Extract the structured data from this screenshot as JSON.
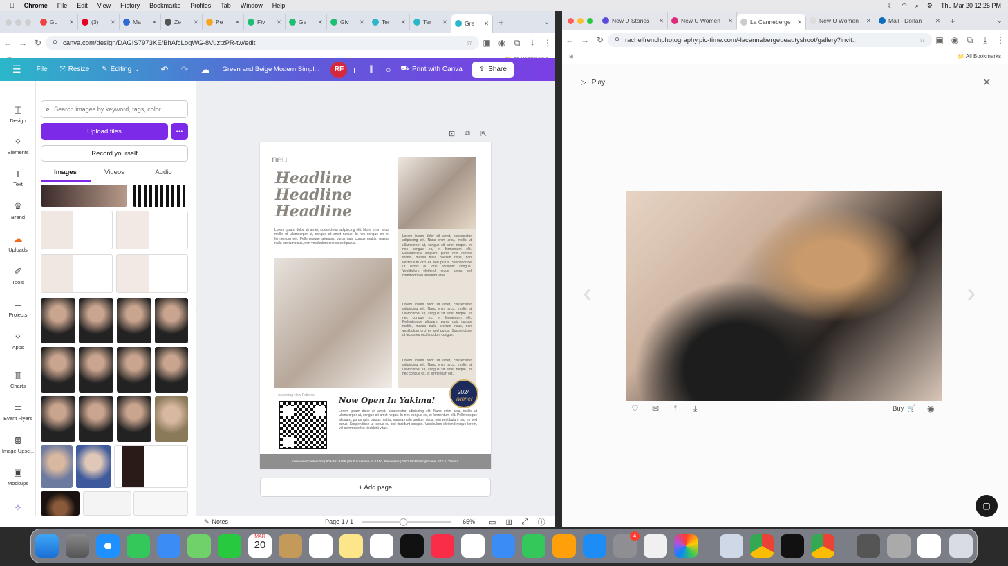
{
  "menubar": {
    "app": "Chrome",
    "items": [
      "File",
      "Edit",
      "View",
      "History",
      "Bookmarks",
      "Profiles",
      "Tab",
      "Window",
      "Help"
    ],
    "datetime": "Thu Mar 20  12:25 PM"
  },
  "left_browser": {
    "tabs": [
      "Gu",
      "(3)",
      "Ma",
      "Ze",
      "Pe",
      "Fiv",
      "Ge",
      "Giv",
      "Ter",
      "Ter",
      "Gre"
    ],
    "url": "canva.com/design/DAGIS7973KE/BhAfcLoqWG-8VuztzPR-tw/edit",
    "bookmarks_label": "All Bookmarks"
  },
  "canva": {
    "toolbar": {
      "file": "File",
      "resize": "Resize",
      "editing": "Editing",
      "design_title": "Green and Beige Modern Simpl...",
      "avatar": "RF",
      "print": "Print with Canva",
      "share": "Share"
    },
    "sidebar": [
      "Design",
      "Elements",
      "Text",
      "Brand",
      "Uploads",
      "Tools",
      "Projects",
      "Apps",
      "Charts",
      "Event Flyers",
      "Image Upsc...",
      "Mockups"
    ],
    "panel": {
      "search_placeholder": "Search images by keyword, tags, color...",
      "upload": "Upload files",
      "more": "•••",
      "record": "Record yourself",
      "tabs": [
        "Images",
        "Videos",
        "Audio"
      ]
    },
    "document": {
      "logo": "neu",
      "headline": [
        "Headline",
        "Headline",
        "Headline"
      ],
      "lorem": "Lorem ipsum dolor sit amet, consectetur adipiscing elit. Nunc enim arcu, mollis ut ullamcorper ut, congue sit amet neque. In nec congue ex, et fermentum elit. Pellentesque aliquam, purus quis cursus mattis, massa nulla pretium risus, non vestibulum orci ex sed purus.",
      "lorem_col": "Lorem ipsum dolor sit amet, consectetur adipiscing elit. Nunc enim arcu, mollis ut ullamcorper ut, congue sit amet neque. In nec congue ex, et fermentum elit. Pellentesque aliquam, purus quis cursus mattis, massa nulla pretium risus, non vestibulum orci ex sed purus. Suspendisse ut lectus eu orci tincidunt congue. Vestibulum eleifend neque lorem, vel commodo leo tincidunt vitae.",
      "lorem_col2": "Lorem ipsum dolor sit amet, consectetur adipiscing elit. Nunc enim arcu, mollis ut ullamcorper ut, congue sit amet neque. In nec congue ex, et fermentum elit. Pellentesque aliquam, purus quis cursus mattis, massa nulla pretium risus, non vestibulum orci ex sed purus. Suspendisse ut lectus eu orci tincidunt congue.",
      "lorem_col3": "Lorem ipsum dolor sit amet, consectetur adipiscing elit. Nunc enim arcu, mollis ut ullamcorper ut, congue sit amet neque. In nec congue ex, et fermentum elit.",
      "accepting": "Accepting New Patients",
      "now_open": "Now Open In Yakima!",
      "lorem_bottom": "Lorem ipsum dolor sit amet, consectetur adipiscing elit. Nunc enim arcu, mollis ut ullamcorper ut, congue sit amet neque. In nec congue ex, et fermentum elit. Pellentesque aliquam, purus quis cursus mattis, massa nulla pretium risus, non vestibulum orci ex sed purus. Suspendisse ut lectus eu orci tincidunt congue. Vestibulum eleifend neque lorem, vel commodo leo tincidunt vitae.",
      "badge_year": "2024",
      "badge_word": "Winner",
      "footer": "neuwomencenter.com  |  509-491-1966  |  95 E Louisiana St # 100, Kennewick  |  2607 W Washington Ave STE 5, Yakima"
    },
    "add_page": "+ Add page",
    "bottom": {
      "notes": "Notes",
      "page": "Page 1 / 1",
      "zoom": "65%",
      "zoom_level": 0.46
    }
  },
  "right_browser": {
    "tabs": [
      "New U Stories",
      "New U Women",
      "La Canneberge",
      "New U Women",
      "Mail - Dorlan"
    ],
    "url": "rachelfrenchphotography.pic-time.com/-lacannebergebeautyshoot/gallery?invit...",
    "bookmarks_label": "All Bookmarks",
    "play": "Play",
    "buy": "Buy"
  },
  "dock": {
    "calendar_month": "MAR",
    "calendar_day": "20",
    "badge": "4"
  },
  "colors": {
    "canva_purple": "#7d2ae8",
    "avatar_red": "#d6283c",
    "accent_teal": "#2bb7c9"
  }
}
